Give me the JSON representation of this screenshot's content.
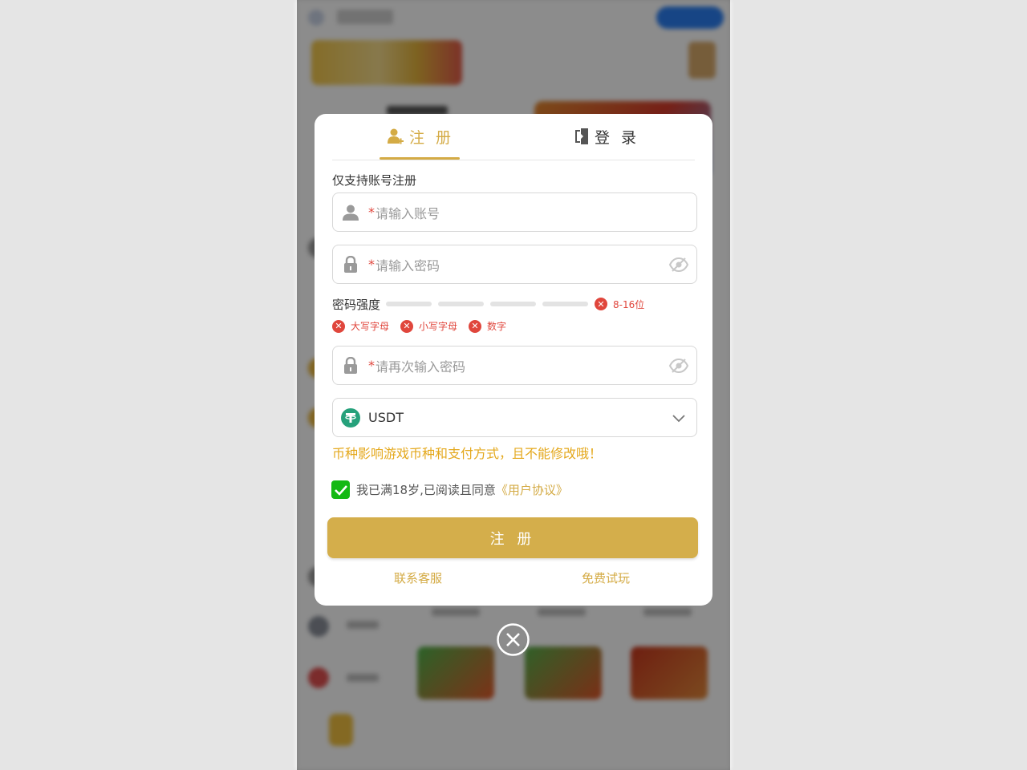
{
  "tabs": {
    "register_label": "注 册",
    "login_label": "登 录"
  },
  "form": {
    "note": "仅支持账号注册",
    "account": {
      "required_mark": "*",
      "placeholder": "请输入账号"
    },
    "password": {
      "required_mark": "*",
      "placeholder": "请输入密码"
    },
    "strength": {
      "label": "密码强度",
      "level": 0,
      "length_rule": "8-16位",
      "rules": [
        "大写字母",
        "小写字母",
        "数字"
      ]
    },
    "confirm_password": {
      "required_mark": "*",
      "placeholder": "请再次输入密码"
    },
    "currency": {
      "selected": "USDT",
      "icon": "tether-icon"
    },
    "currency_note": "币种影响游戏币种和支付方式，且不能修改哦！",
    "agreement": {
      "checked": true,
      "text": "我已满18岁,已阅读且同意",
      "link": "《用户协议》"
    },
    "submit_label": "注 册"
  },
  "links": {
    "support": "联系客服",
    "trial": "免费试玩"
  },
  "colors": {
    "accent": "#d4ab45",
    "error": "#e0463c",
    "warning": "#e4a81c",
    "check": "#13b913",
    "tether": "#26a17b"
  }
}
